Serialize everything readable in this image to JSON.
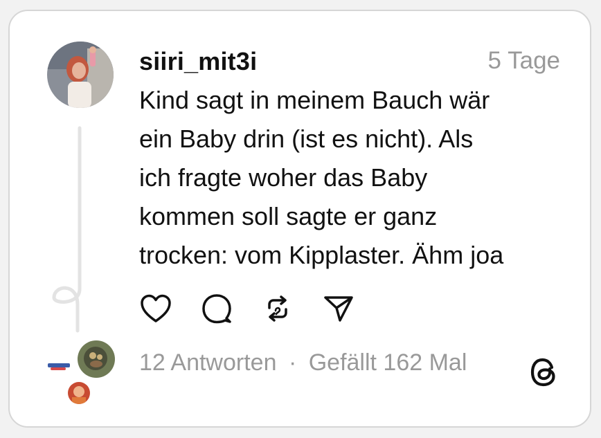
{
  "post": {
    "username": "siiri_mit3i",
    "timestamp": "5 Tage",
    "text_lines": [
      "Kind sagt in meinem Bauch wär",
      "ein Baby drin (ist es nicht). Als",
      "ich fragte woher das Baby",
      "kommen soll sagte er ganz",
      "trocken: vom Kipplaster. Ähm joa"
    ]
  },
  "actions": {
    "like_icon": "heart-icon",
    "comment_icon": "comment-bubble-icon",
    "repost_icon": "repost-icon",
    "share_icon": "send-icon"
  },
  "footer": {
    "replies": "12 Antworten",
    "separator": "·",
    "likes": "Gefällt 162 Mal",
    "brand_icon": "threads-logo-icon"
  },
  "colors": {
    "text": "#111111",
    "muted": "#999999",
    "border": "#d6d6d6",
    "thread_line": "#e3e3e3"
  }
}
